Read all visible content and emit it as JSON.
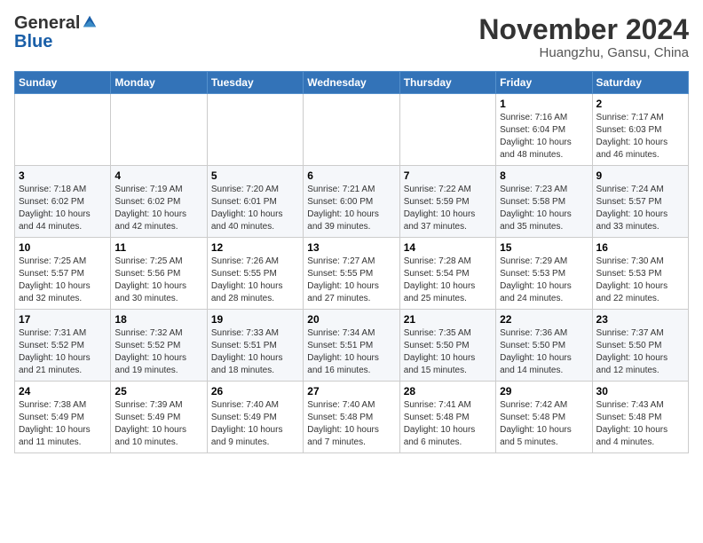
{
  "header": {
    "logo_general": "General",
    "logo_blue": "Blue",
    "month_title": "November 2024",
    "location": "Huangzhu, Gansu, China"
  },
  "calendar": {
    "weekdays": [
      "Sunday",
      "Monday",
      "Tuesday",
      "Wednesday",
      "Thursday",
      "Friday",
      "Saturday"
    ],
    "weeks": [
      [
        {
          "day": "",
          "info": ""
        },
        {
          "day": "",
          "info": ""
        },
        {
          "day": "",
          "info": ""
        },
        {
          "day": "",
          "info": ""
        },
        {
          "day": "",
          "info": ""
        },
        {
          "day": "1",
          "info": "Sunrise: 7:16 AM\nSunset: 6:04 PM\nDaylight: 10 hours and 48 minutes."
        },
        {
          "day": "2",
          "info": "Sunrise: 7:17 AM\nSunset: 6:03 PM\nDaylight: 10 hours and 46 minutes."
        }
      ],
      [
        {
          "day": "3",
          "info": "Sunrise: 7:18 AM\nSunset: 6:02 PM\nDaylight: 10 hours and 44 minutes."
        },
        {
          "day": "4",
          "info": "Sunrise: 7:19 AM\nSunset: 6:02 PM\nDaylight: 10 hours and 42 minutes."
        },
        {
          "day": "5",
          "info": "Sunrise: 7:20 AM\nSunset: 6:01 PM\nDaylight: 10 hours and 40 minutes."
        },
        {
          "day": "6",
          "info": "Sunrise: 7:21 AM\nSunset: 6:00 PM\nDaylight: 10 hours and 39 minutes."
        },
        {
          "day": "7",
          "info": "Sunrise: 7:22 AM\nSunset: 5:59 PM\nDaylight: 10 hours and 37 minutes."
        },
        {
          "day": "8",
          "info": "Sunrise: 7:23 AM\nSunset: 5:58 PM\nDaylight: 10 hours and 35 minutes."
        },
        {
          "day": "9",
          "info": "Sunrise: 7:24 AM\nSunset: 5:57 PM\nDaylight: 10 hours and 33 minutes."
        }
      ],
      [
        {
          "day": "10",
          "info": "Sunrise: 7:25 AM\nSunset: 5:57 PM\nDaylight: 10 hours and 32 minutes."
        },
        {
          "day": "11",
          "info": "Sunrise: 7:25 AM\nSunset: 5:56 PM\nDaylight: 10 hours and 30 minutes."
        },
        {
          "day": "12",
          "info": "Sunrise: 7:26 AM\nSunset: 5:55 PM\nDaylight: 10 hours and 28 minutes."
        },
        {
          "day": "13",
          "info": "Sunrise: 7:27 AM\nSunset: 5:55 PM\nDaylight: 10 hours and 27 minutes."
        },
        {
          "day": "14",
          "info": "Sunrise: 7:28 AM\nSunset: 5:54 PM\nDaylight: 10 hours and 25 minutes."
        },
        {
          "day": "15",
          "info": "Sunrise: 7:29 AM\nSunset: 5:53 PM\nDaylight: 10 hours and 24 minutes."
        },
        {
          "day": "16",
          "info": "Sunrise: 7:30 AM\nSunset: 5:53 PM\nDaylight: 10 hours and 22 minutes."
        }
      ],
      [
        {
          "day": "17",
          "info": "Sunrise: 7:31 AM\nSunset: 5:52 PM\nDaylight: 10 hours and 21 minutes."
        },
        {
          "day": "18",
          "info": "Sunrise: 7:32 AM\nSunset: 5:52 PM\nDaylight: 10 hours and 19 minutes."
        },
        {
          "day": "19",
          "info": "Sunrise: 7:33 AM\nSunset: 5:51 PM\nDaylight: 10 hours and 18 minutes."
        },
        {
          "day": "20",
          "info": "Sunrise: 7:34 AM\nSunset: 5:51 PM\nDaylight: 10 hours and 16 minutes."
        },
        {
          "day": "21",
          "info": "Sunrise: 7:35 AM\nSunset: 5:50 PM\nDaylight: 10 hours and 15 minutes."
        },
        {
          "day": "22",
          "info": "Sunrise: 7:36 AM\nSunset: 5:50 PM\nDaylight: 10 hours and 14 minutes."
        },
        {
          "day": "23",
          "info": "Sunrise: 7:37 AM\nSunset: 5:50 PM\nDaylight: 10 hours and 12 minutes."
        }
      ],
      [
        {
          "day": "24",
          "info": "Sunrise: 7:38 AM\nSunset: 5:49 PM\nDaylight: 10 hours and 11 minutes."
        },
        {
          "day": "25",
          "info": "Sunrise: 7:39 AM\nSunset: 5:49 PM\nDaylight: 10 hours and 10 minutes."
        },
        {
          "day": "26",
          "info": "Sunrise: 7:40 AM\nSunset: 5:49 PM\nDaylight: 10 hours and 9 minutes."
        },
        {
          "day": "27",
          "info": "Sunrise: 7:40 AM\nSunset: 5:48 PM\nDaylight: 10 hours and 7 minutes."
        },
        {
          "day": "28",
          "info": "Sunrise: 7:41 AM\nSunset: 5:48 PM\nDaylight: 10 hours and 6 minutes."
        },
        {
          "day": "29",
          "info": "Sunrise: 7:42 AM\nSunset: 5:48 PM\nDaylight: 10 hours and 5 minutes."
        },
        {
          "day": "30",
          "info": "Sunrise: 7:43 AM\nSunset: 5:48 PM\nDaylight: 10 hours and 4 minutes."
        }
      ]
    ]
  }
}
